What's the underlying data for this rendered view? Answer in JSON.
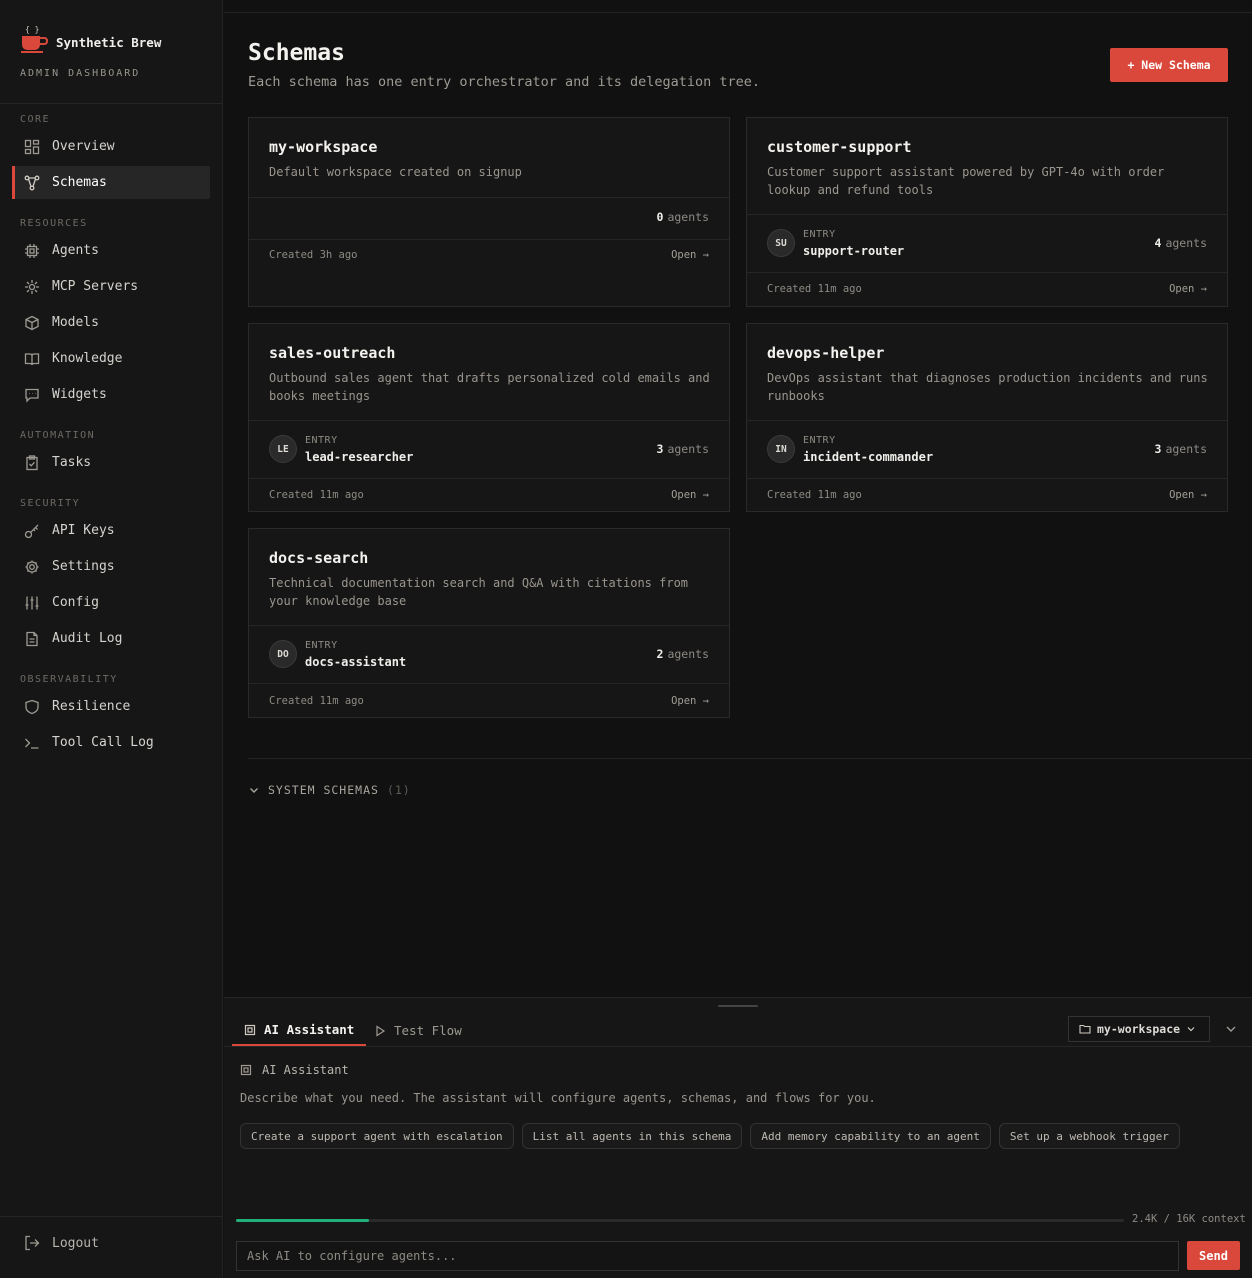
{
  "brand": {
    "name": "Synthetic Brew",
    "subtitle": "ADMIN DASHBOARD"
  },
  "sidebar": {
    "sections": {
      "core": "CORE",
      "resources": "RESOURCES",
      "automation": "AUTOMATION",
      "security": "SECURITY",
      "observability": "OBSERVABILITY"
    },
    "items": {
      "overview": "Overview",
      "schemas": "Schemas",
      "agents": "Agents",
      "mcp": "MCP Servers",
      "models": "Models",
      "knowledge": "Knowledge",
      "widgets": "Widgets",
      "tasks": "Tasks",
      "api_keys": "API Keys",
      "settings": "Settings",
      "config": "Config",
      "audit": "Audit Log",
      "resilience": "Resilience",
      "toolcall": "Tool Call Log"
    },
    "active": "Schemas",
    "logout": "Logout"
  },
  "page": {
    "title": "Schemas",
    "subtitle": "Each schema has one entry orchestrator and its delegation tree.",
    "new_button": "+ New Schema"
  },
  "cards": [
    {
      "name": "my-workspace",
      "description": "Default workspace created on signup",
      "entry_initials": "",
      "entry_label": "",
      "entry_name": "",
      "agents": "0",
      "agents_label": "agents",
      "created": "Created 3h ago",
      "open": "Open →"
    },
    {
      "name": "customer-support",
      "description": "Customer support assistant powered by GPT-4o with order lookup and refund tools",
      "entry_initials": "SU",
      "entry_label": "ENTRY",
      "entry_name": "support-router",
      "agents": "4",
      "agents_label": "agents",
      "created": "Created 11m ago",
      "open": "Open →"
    },
    {
      "name": "sales-outreach",
      "description": "Outbound sales agent that drafts personalized cold emails and books meetings",
      "entry_initials": "LE",
      "entry_label": "ENTRY",
      "entry_name": "lead-researcher",
      "agents": "3",
      "agents_label": "agents",
      "created": "Created 11m ago",
      "open": "Open →"
    },
    {
      "name": "devops-helper",
      "description": "DevOps assistant that diagnoses production incidents and runs runbooks",
      "entry_initials": "IN",
      "entry_label": "ENTRY",
      "entry_name": "incident-commander",
      "agents": "3",
      "agents_label": "agents",
      "created": "Created 11m ago",
      "open": "Open →"
    },
    {
      "name": "docs-search",
      "description": "Technical documentation search and Q&A with citations from your knowledge base",
      "entry_initials": "DO",
      "entry_label": "ENTRY",
      "entry_name": "docs-assistant",
      "agents": "2",
      "agents_label": "agents",
      "created": "Created 11m ago",
      "open": "Open →"
    }
  ],
  "system_schemas": {
    "label": "SYSTEM SCHEMAS",
    "count": "(1)"
  },
  "panel": {
    "tabs": {
      "assistant": "AI Assistant",
      "test_flow": "Test Flow"
    },
    "workspace": "my-workspace",
    "assistant_label": "AI Assistant",
    "description": "Describe what you need. The assistant will configure agents, schemas, and flows for you.",
    "chips": [
      "Create a support agent with escalation",
      "List all agents in this schema",
      "Add memory capability to an agent",
      "Set up a webhook trigger"
    ],
    "context_label": "2.4K / 16K context",
    "context_fraction": 0.15,
    "input_placeholder": "Ask AI to configure agents...",
    "send": "Send"
  },
  "colors": {
    "accent": "#d9483b",
    "progress": "#22b07a",
    "background": "#111111"
  }
}
